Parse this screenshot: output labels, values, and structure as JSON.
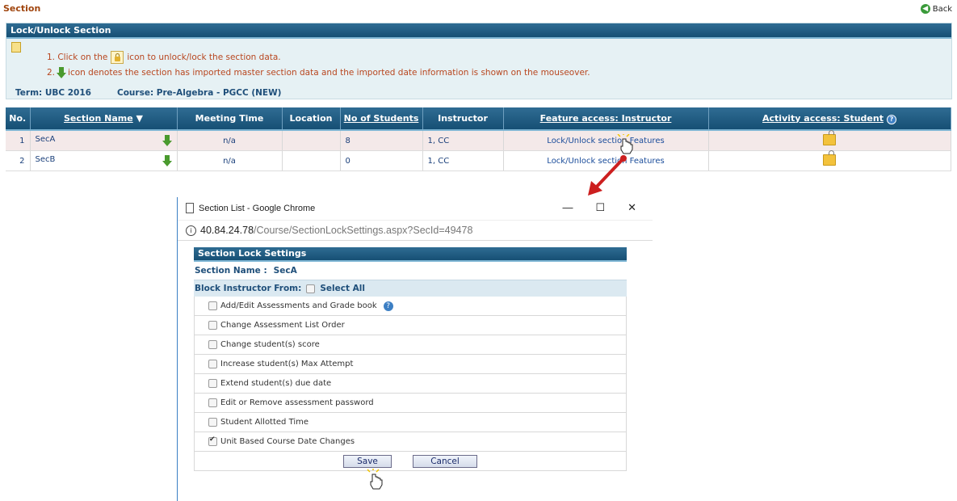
{
  "page": {
    "title": "Section",
    "back_label": "Back"
  },
  "panel": {
    "header": "Lock/Unlock Section",
    "instruction1_prefix": "1. Click on the",
    "instruction1_suffix": "icon to unlock/lock the section data.",
    "instruction2_prefix": "2.",
    "instruction2_suffix": "icon denotes the section has imported master section data and the imported date information is shown on the mouseover.",
    "term": "Term: UBC 2016",
    "course": "Course: Pre-Algebra - PGCC (NEW)"
  },
  "table": {
    "headers": [
      "No.",
      "Section Name",
      "Meeting Time",
      "Location",
      "No of Students",
      "Instructor",
      "Feature access: Instructor",
      "Activity access: Student"
    ],
    "rows": [
      {
        "no": "1",
        "name": "SecA",
        "meeting": "n/a",
        "location": "",
        "students": "8",
        "instructor": "1, CC",
        "feature": "Lock/Unlock section Features"
      },
      {
        "no": "2",
        "name": "SecB",
        "meeting": "n/a",
        "location": "",
        "students": "0",
        "instructor": "1, CC",
        "feature": "Lock/Unlock section Features"
      }
    ]
  },
  "popup": {
    "window_title": "Section List - Google Chrome",
    "url_host": "40.84.24.78",
    "url_path": "/Course/SectionLockSettings.aspx?SecId=49478",
    "header": "Section Lock Settings",
    "section_name_label": "Section Name :",
    "section_name_value": "SecA",
    "block_label": "Block Instructor From:",
    "select_all_label": "Select All",
    "options": [
      {
        "label": "Add/Edit Assessments and Grade book",
        "checked": false
      },
      {
        "label": "Change Assessment List Order",
        "checked": false
      },
      {
        "label": "Change student(s) score",
        "checked": false
      },
      {
        "label": "Increase student(s) Max Attempt",
        "checked": false
      },
      {
        "label": "Extend student(s) due date",
        "checked": false
      },
      {
        "label": "Edit or Remove assessment password",
        "checked": false
      },
      {
        "label": "Student Allotted Time",
        "checked": false
      },
      {
        "label": "Unit Based Course Date Changes",
        "checked": true
      }
    ],
    "save_label": "Save",
    "cancel_label": "Cancel"
  },
  "colors": {
    "header_blue": "#164f74",
    "title_orange": "#a0450e",
    "annotation_red": "#cc1f1f"
  }
}
